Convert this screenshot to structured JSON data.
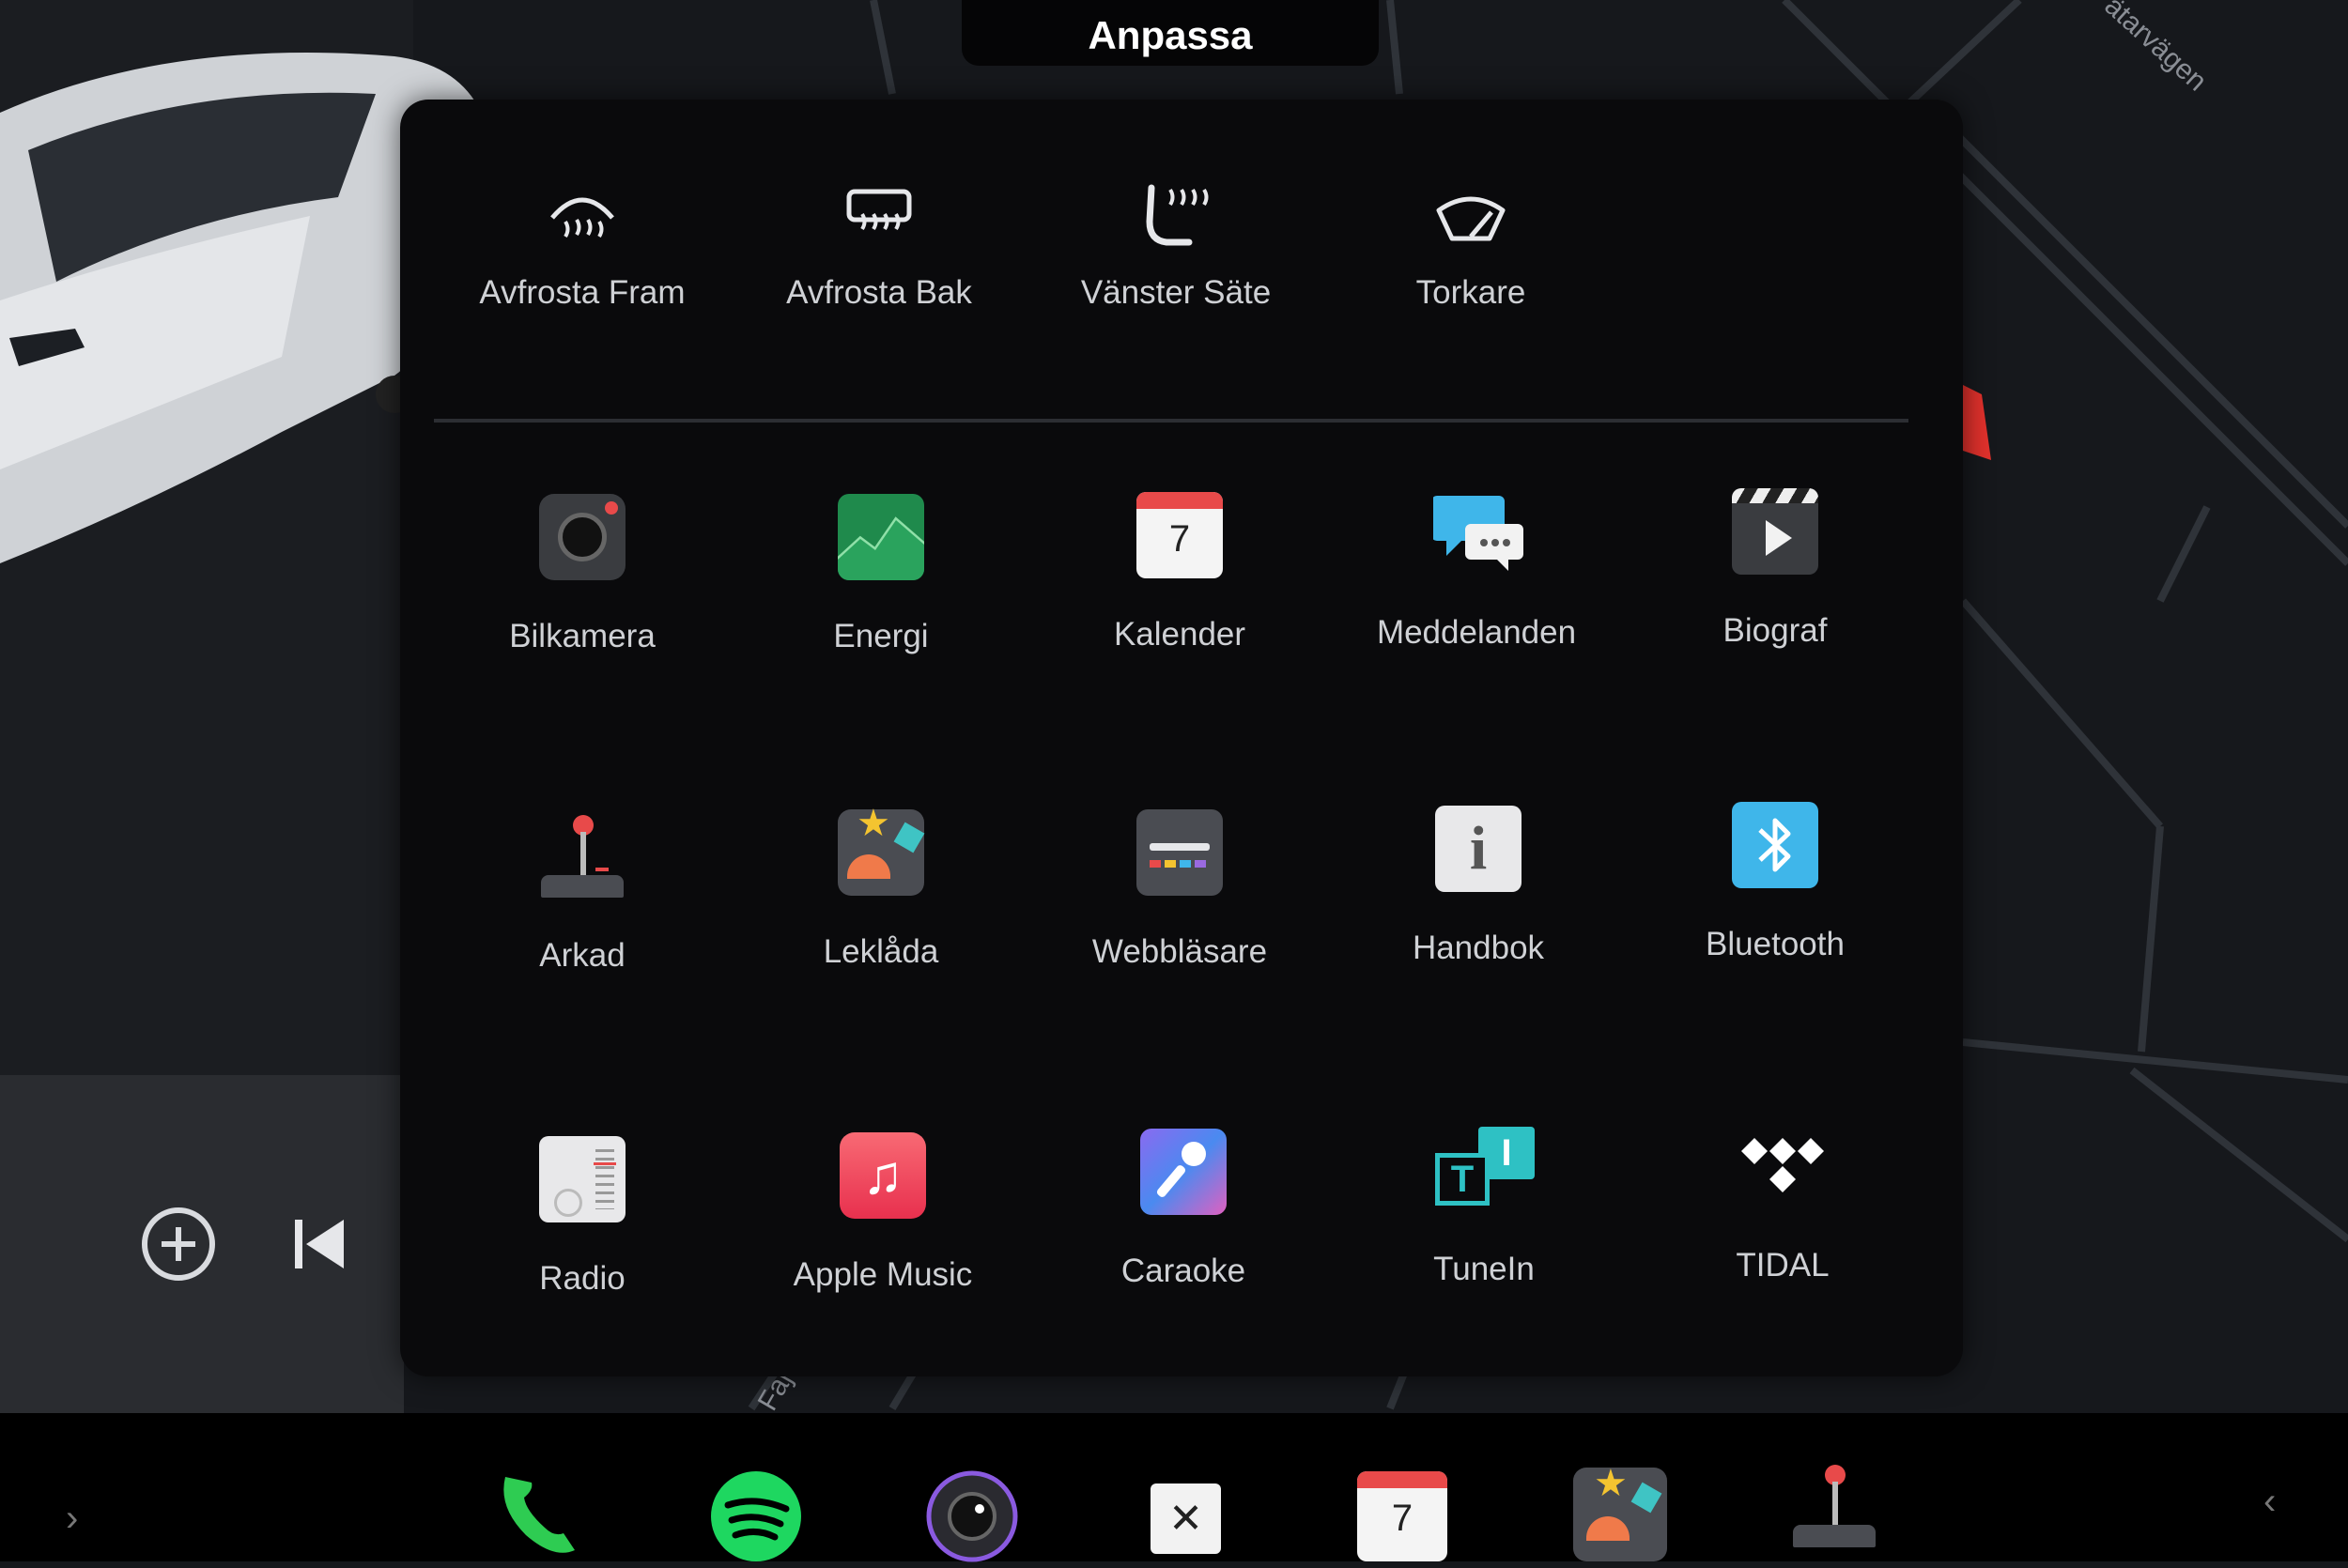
{
  "header": {
    "title": "Anpassa"
  },
  "map": {
    "street_label": "ätarvägen",
    "street_label_2": "Faj"
  },
  "quick_controls": [
    {
      "label": "Avfrosta Fram",
      "icon": "defrost-front-icon"
    },
    {
      "label": "Avfrosta Bak",
      "icon": "defrost-rear-icon"
    },
    {
      "label": "Vänster Säte",
      "icon": "seat-heat-icon"
    },
    {
      "label": "Torkare",
      "icon": "wiper-icon"
    }
  ],
  "apps": [
    {
      "label": "Bilkamera",
      "icon": "camera-icon"
    },
    {
      "label": "Energi",
      "icon": "energy-icon"
    },
    {
      "label": "Kalender",
      "icon": "calendar-icon",
      "day": "7"
    },
    {
      "label": "Meddelanden",
      "icon": "messages-icon"
    },
    {
      "label": "Biograf",
      "icon": "theater-icon"
    },
    {
      "label": "Arkad",
      "icon": "arcade-icon"
    },
    {
      "label": "Leklåda",
      "icon": "toybox-icon"
    },
    {
      "label": "Webbläsare",
      "icon": "browser-icon"
    },
    {
      "label": "Handbok",
      "icon": "manual-icon",
      "glyph": "i"
    },
    {
      "label": "Bluetooth",
      "icon": "bluetooth-icon"
    },
    {
      "label": "Radio",
      "icon": "radio-icon"
    },
    {
      "label": "Apple Music",
      "icon": "apple-music-icon",
      "glyph": "♫"
    },
    {
      "label": "Caraoke",
      "icon": "caraoke-icon"
    },
    {
      "label": "TuneIn",
      "icon": "tunein-icon",
      "glyph_t": "T",
      "glyph_i": "I"
    },
    {
      "label": "TIDAL",
      "icon": "tidal-icon"
    }
  ],
  "dock": {
    "calendar_day": "7",
    "close_glyph": "✕",
    "left_chevron": "›",
    "right_chevron": "‹",
    "items": [
      "phone-icon",
      "spotify-icon",
      "camera-icon",
      "close-icon",
      "calendar-icon",
      "toybox-icon",
      "arcade-icon"
    ]
  },
  "colors": {
    "accent_bluetooth": "#3fb6ea",
    "energy": "#1f8a4c",
    "music": "#f0415a",
    "tunein": "#2ec1c4",
    "spotify": "#1ed760",
    "phone": "#2ecc52"
  }
}
